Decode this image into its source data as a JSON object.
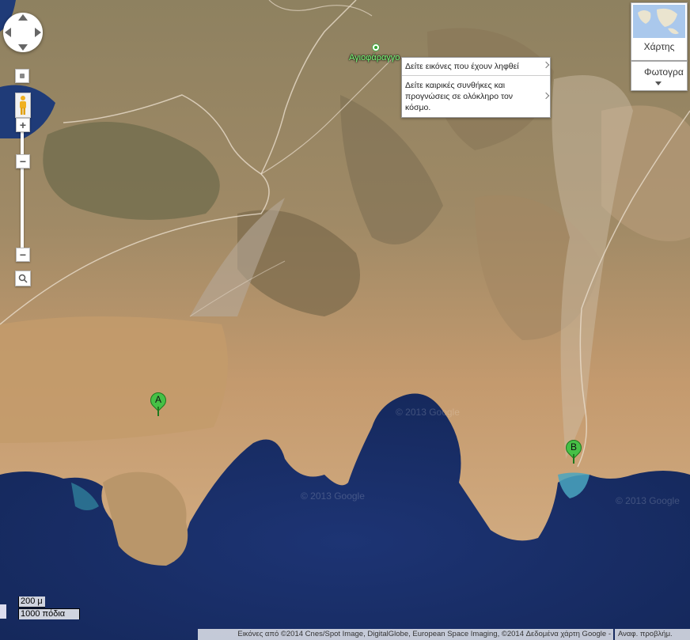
{
  "map": {
    "water_color": "#1a2f6a",
    "land_color": "#c9a57a",
    "place_label": "Αγιοφάραγγο",
    "watermark": "© 2013 Google"
  },
  "controls": {
    "pan_icon": "pan-arrows",
    "zoom_in_label": "+",
    "zoom_out_label": "−",
    "map_button_label": "Χάρτης",
    "photo_button_label": "Φωτογρα"
  },
  "tooltip": {
    "item1": "Δείτε εικόνες που έχουν ληφθεί",
    "item2": "Δείτε καιρικές συνθήκες και προγνώσεις σε ολόκληρο τον κόσμο."
  },
  "markers": [
    {
      "label": "A"
    },
    {
      "label": "B"
    }
  ],
  "scale": {
    "metric": "200 μ",
    "imperial": "1000 πόδια"
  },
  "footer": {
    "attribution": "Εικόνες από ©2014 Cnes/Spot Image, DigitalGlobe, European Space Imaging, ©2014 Δεδομένα χάρτη Google -",
    "report": "Αναφ. προβλήμ."
  }
}
